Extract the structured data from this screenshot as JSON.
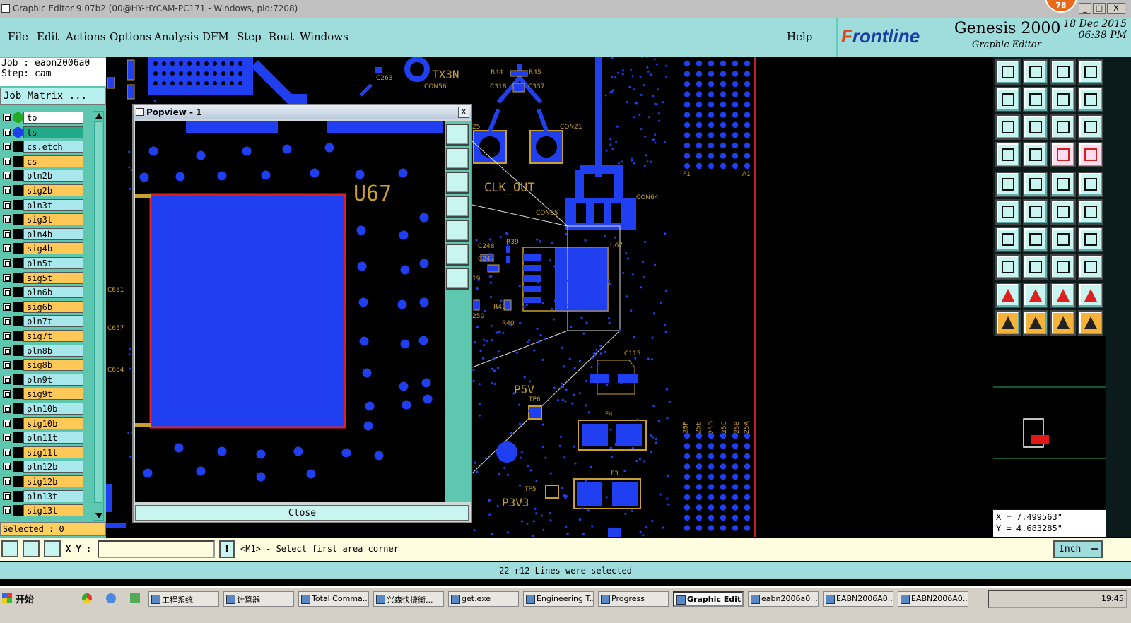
{
  "window": {
    "title": "Graphic Editor 9.07b2 (00@HY-HYCAM-PC171 - Windows, pid:7208)",
    "badge": "78",
    "controls": [
      "_",
      "□",
      "X"
    ]
  },
  "menu": {
    "items": [
      "File",
      "Edit",
      "Actions",
      "Options",
      "Analysis",
      "DFM",
      "Step",
      "Rout",
      "Windows"
    ],
    "help": "Help"
  },
  "brand": {
    "logo_f": "F",
    "logo_rest": "rontline",
    "product": "Genesis 2000",
    "subtitle": "Graphic Editor",
    "date": "18 Dec 2015",
    "time": "06:38 PM"
  },
  "job": {
    "job_label": "Job : eabn2006a0",
    "step_label": "Step: cam",
    "matrix_button": "Job Matrix ..."
  },
  "layers": [
    {
      "name": "to",
      "color": "#ffffff",
      "swatch": "#22aa22"
    },
    {
      "name": "ts",
      "color": "#22aa88",
      "swatch": "#1f3ff0"
    },
    {
      "name": "cs.etch",
      "color": "#a8e8ec",
      "swatch": "#000000"
    },
    {
      "name": "cs",
      "color": "#ffc857",
      "swatch": "#000000"
    },
    {
      "name": "pln2b",
      "color": "#a8e8ec",
      "swatch": "#000000"
    },
    {
      "name": "sig2b",
      "color": "#ffc857",
      "swatch": "#000000"
    },
    {
      "name": "pln3t",
      "color": "#a8e8ec",
      "swatch": "#000000"
    },
    {
      "name": "sig3t",
      "color": "#ffc857",
      "swatch": "#000000"
    },
    {
      "name": "pln4b",
      "color": "#a8e8ec",
      "swatch": "#000000"
    },
    {
      "name": "sig4b",
      "color": "#ffc857",
      "swatch": "#000000"
    },
    {
      "name": "pln5t",
      "color": "#a8e8ec",
      "swatch": "#000000"
    },
    {
      "name": "sig5t",
      "color": "#ffc857",
      "swatch": "#000000"
    },
    {
      "name": "pln6b",
      "color": "#a8e8ec",
      "swatch": "#000000"
    },
    {
      "name": "sig6b",
      "color": "#ffc857",
      "swatch": "#000000"
    },
    {
      "name": "pln7t",
      "color": "#a8e8ec",
      "swatch": "#000000"
    },
    {
      "name": "sig7t",
      "color": "#ffc857",
      "swatch": "#000000"
    },
    {
      "name": "pln8b",
      "color": "#a8e8ec",
      "swatch": "#000000"
    },
    {
      "name": "sig8b",
      "color": "#ffc857",
      "swatch": "#000000"
    },
    {
      "name": "pln9t",
      "color": "#a8e8ec",
      "swatch": "#000000"
    },
    {
      "name": "sig9t",
      "color": "#ffc857",
      "swatch": "#000000"
    },
    {
      "name": "pln10b",
      "color": "#a8e8ec",
      "swatch": "#000000"
    },
    {
      "name": "sig10b",
      "color": "#ffc857",
      "swatch": "#000000"
    },
    {
      "name": "pln11t",
      "color": "#a8e8ec",
      "swatch": "#000000"
    },
    {
      "name": "sig11t",
      "color": "#ffc857",
      "swatch": "#000000"
    },
    {
      "name": "pln12b",
      "color": "#a8e8ec",
      "swatch": "#000000"
    },
    {
      "name": "sig12b",
      "color": "#ffc857",
      "swatch": "#000000"
    },
    {
      "name": "pln13t",
      "color": "#a8e8ec",
      "swatch": "#000000"
    },
    {
      "name": "sig13t",
      "color": "#ffc857",
      "swatch": "#000000"
    }
  ],
  "selected": "Selected : 0",
  "popview": {
    "title": "Popview - 1",
    "close": "Close",
    "close_x": "X",
    "component": "U67"
  },
  "board_labels": {
    "tx3n": "TX3N",
    "clk_out": "CLK_OUT",
    "p5v": "P5V",
    "p3v3": "P3V3",
    "r44": "R44",
    "r45": "R45",
    "c318": "C318",
    "c337": "C337",
    "con56": "CON56",
    "con21": "CON21",
    "con64": "CON64",
    "con65": "CON65",
    "u67": "U67",
    "c115": "C115",
    "f4": "F4",
    "f3": "F3",
    "tp6": "TP6",
    "tp5": "TP5",
    "r39": "R39",
    "c248": "C248",
    "c247": "C247",
    "r40": "R40",
    "r41": "R41",
    "c263": "C263",
    "c651": "C651",
    "c657": "C657",
    "c654": "C654",
    "f1": "F1",
    "a1": "A1",
    "col_25f": "25F",
    "col_25e": "25E",
    "col_25d": "25D",
    "col_25c": "25C",
    "col_25b": "25B",
    "col_25a": "25A",
    "pin_19": "19",
    "pin_250": "250",
    "pin_25": "25"
  },
  "coords": {
    "x": "X = 7.499563\"",
    "y": "Y = 4.683285\""
  },
  "command": {
    "xy_label": "X Y :",
    "input_value": "",
    "prompt": "<M1> - Select first area corner",
    "units": "Inch"
  },
  "status": "22 r12 Lines were selected",
  "taskbar": {
    "start": "开始",
    "tasks": [
      "工程系统",
      "计算器",
      "Total Comma...",
      "兴森快捷衡...",
      "get.exe",
      "Engineering T...",
      "Progress",
      "Graphic Edit...",
      "eabn2006a0 ...",
      "EABN2006A0...",
      "EABN2006A0..."
    ],
    "clock": "19:45"
  }
}
